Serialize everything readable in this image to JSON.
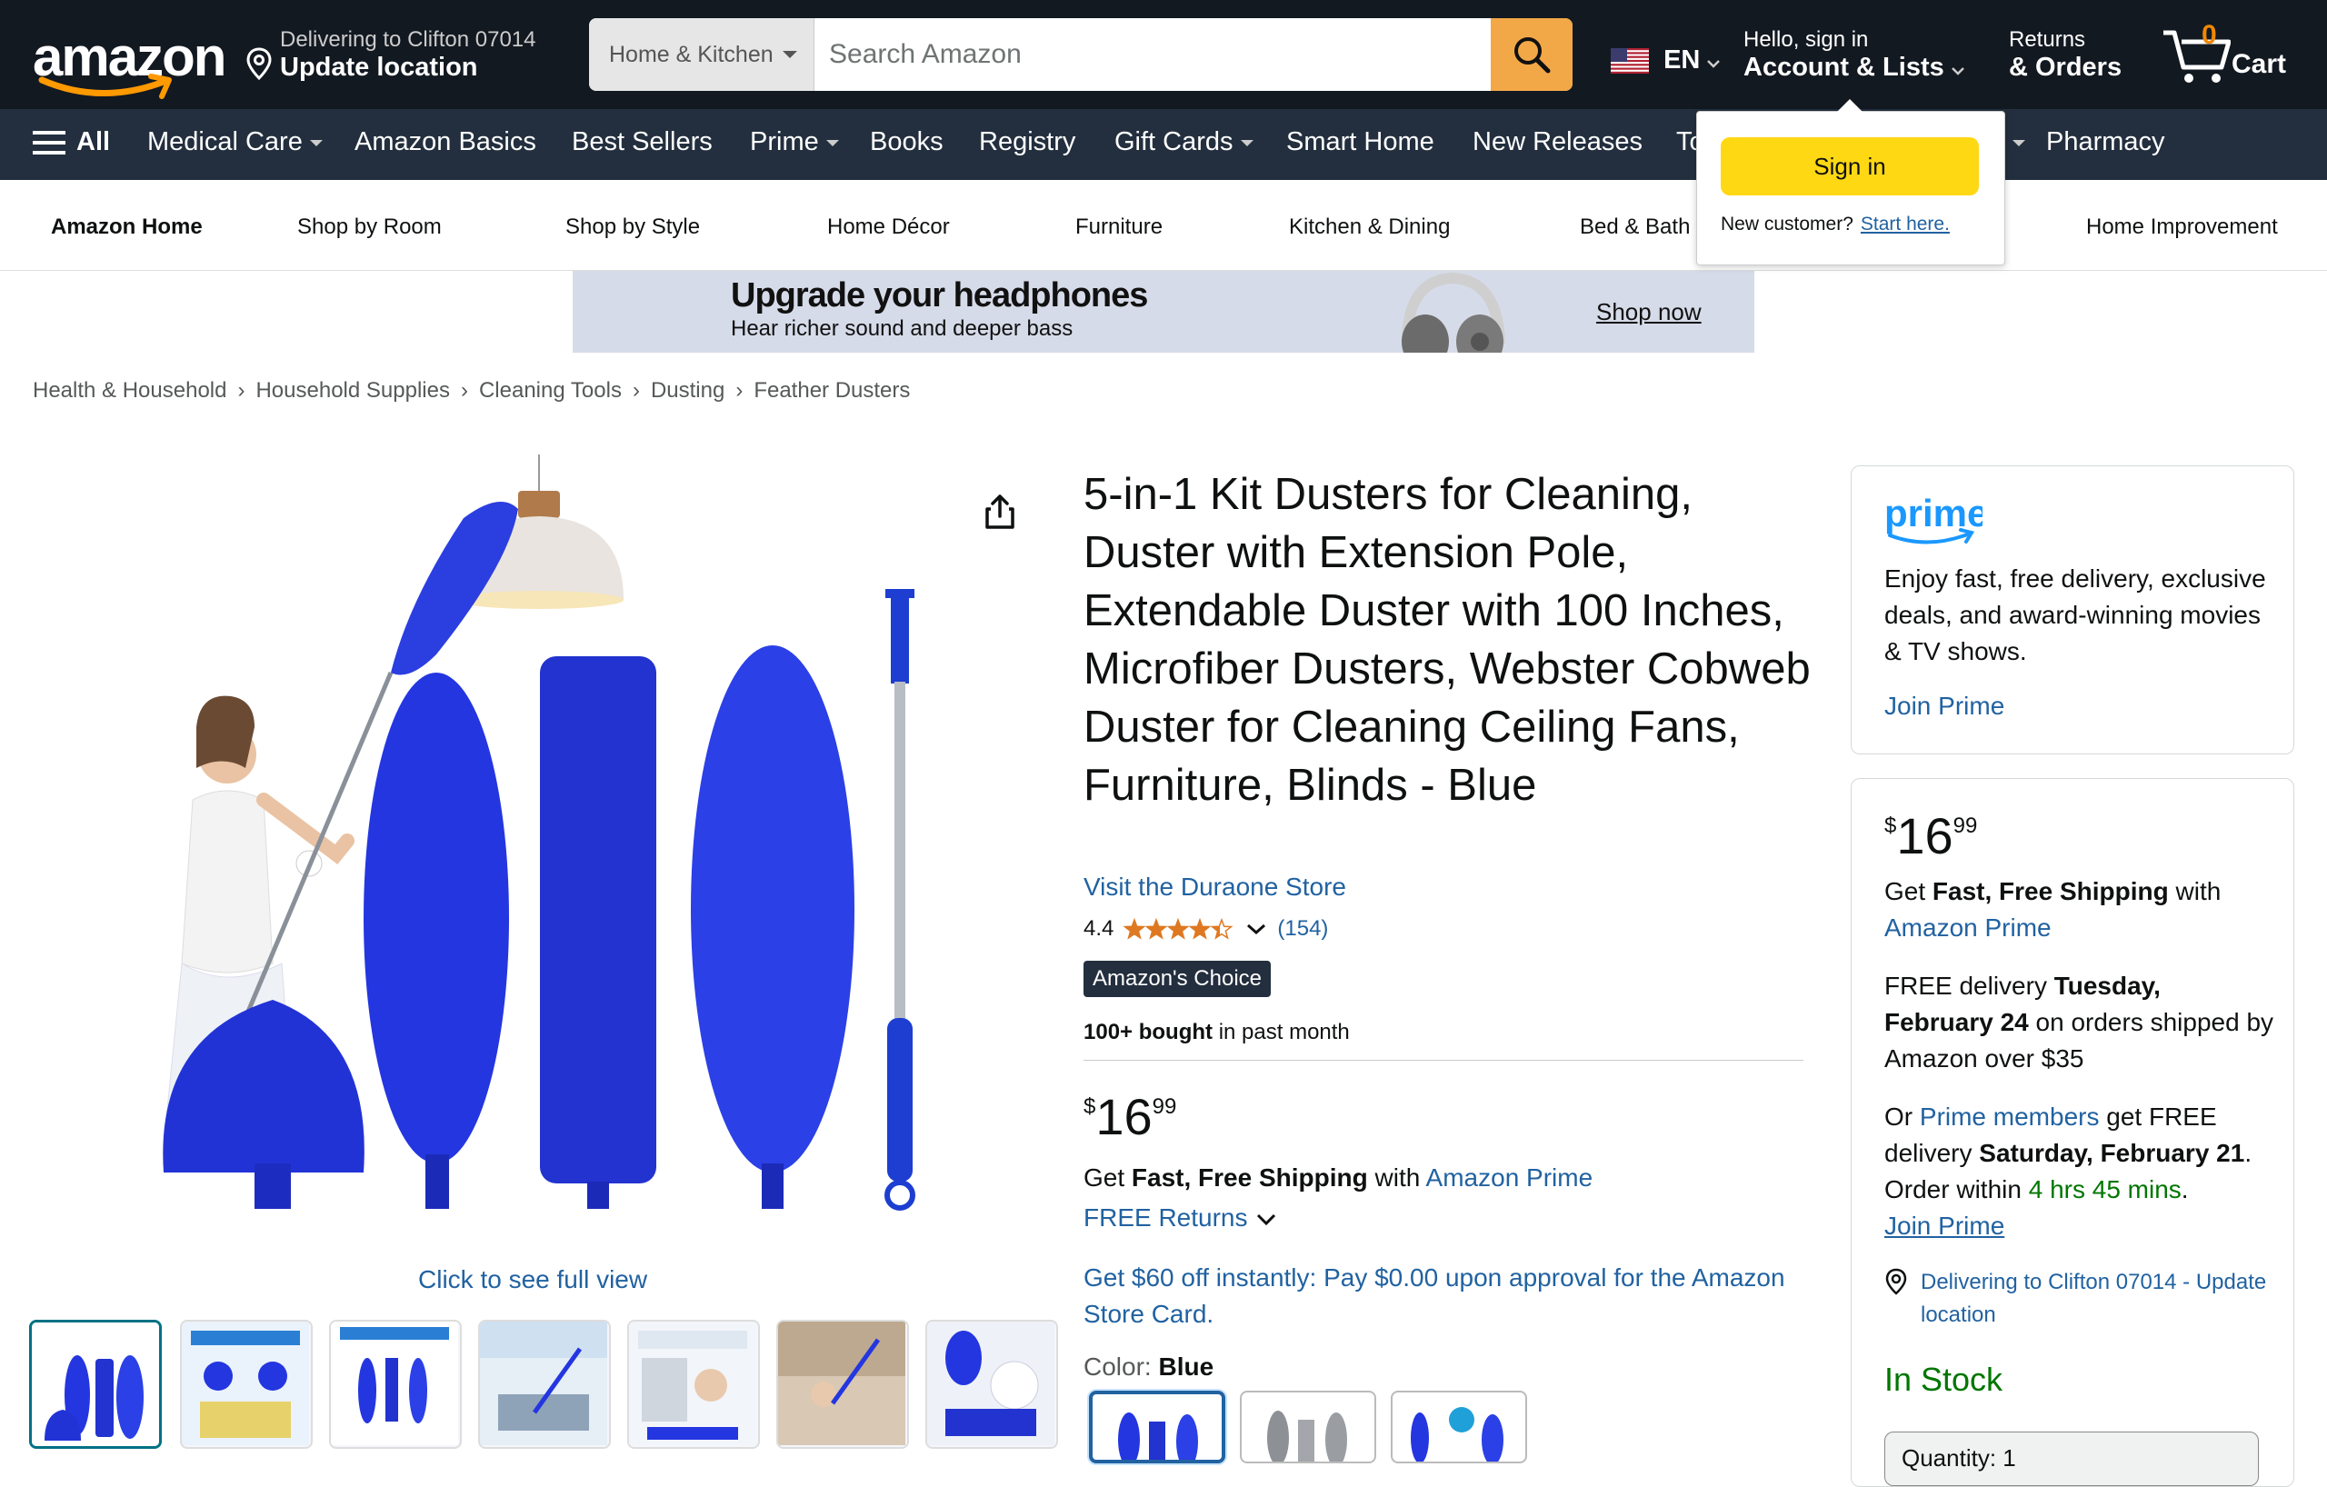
{
  "header": {
    "logo_text": "amazon",
    "delivery_line1": "Delivering to Clifton 07014",
    "delivery_line2": "Update location",
    "search_category": "Home & Kitchen",
    "search_placeholder": "Search Amazon",
    "language": "EN",
    "account_line1": "Hello, sign in",
    "account_line2": "Account & Lists",
    "orders_line1": "Returns",
    "orders_line2": "& Orders",
    "cart_count": "0",
    "cart_label": "Cart"
  },
  "nav": {
    "all_label": "All",
    "items": [
      "Medical Care",
      "Amazon Basics",
      "Best Sellers",
      "Prime",
      "Books",
      "Registry",
      "Gift Cards",
      "Smart Home",
      "New Releases",
      "To",
      "Pharmacy"
    ]
  },
  "subnav": {
    "items": [
      "Amazon Home",
      "Shop by Room",
      "Shop by Style",
      "Home Décor",
      "Furniture",
      "Kitchen & Dining",
      "Bed & Bath",
      "Home Improvement"
    ]
  },
  "banner": {
    "headline": "Upgrade your headphones",
    "subline": "Hear richer sound and deeper bass",
    "cta": "Shop now"
  },
  "flyout": {
    "signin_label": "Sign in",
    "new_customer": "New customer?",
    "start_here": "Start here."
  },
  "breadcrumb": [
    "Health & Household",
    "Household Supplies",
    "Cleaning Tools",
    "Dusting",
    "Feather Dusters"
  ],
  "breadcrumb_sep": "›",
  "gallery": {
    "click_full_view": "Click to see full view"
  },
  "product": {
    "title": "5-in-1 Kit Dusters for Cleaning, Duster with Extension Pole, Extendable Duster with 100 Inches, Microfiber Dusters, Webster Cobweb Duster for Cleaning Ceiling Fans, Furniture, Blinds - Blue",
    "store_link": "Visit the Duraone Store",
    "rating_value": "4.4",
    "rating_stars": 4.4,
    "rating_count": "(154)",
    "badge": "Amazon's Choice",
    "bought_bold": "100+ bought",
    "bought_rest": " in past month",
    "price_symbol": "$",
    "price_whole": "16",
    "price_fraction": "99",
    "shipping_pre": "Get ",
    "shipping_bold": "Fast, Free Shipping",
    "shipping_mid": " with ",
    "shipping_link": "Amazon Prime",
    "returns": "FREE Returns",
    "card_offer": "Get $60 off instantly: Pay $0.00 upon approval for the Amazon Store Card.",
    "color_label": "Color: ",
    "color_value": "Blue"
  },
  "prime_box": {
    "logo": "prime",
    "text": "Enjoy fast, free delivery, exclusive deals, and award-winning movies & TV shows.",
    "join": "Join Prime"
  },
  "buy_box": {
    "price_symbol": "$",
    "price_whole": "16",
    "price_fraction": "99",
    "ship_pre": "Get ",
    "ship_bold": "Fast, Free Shipping",
    "ship_mid": " with",
    "ship_link": "Amazon Prime",
    "del_pre": "FREE delivery ",
    "del_bold": "Tuesday, February 24",
    "del_rest": " on orders shipped by Amazon over $35",
    "or_pre": "Or ",
    "or_link": "Prime members",
    "or_mid": " get FREE delivery ",
    "or_bold": "Saturday, February 21",
    "or_mid2": ". Order within ",
    "or_time": "4 hrs 45 mins",
    "or_end": ".",
    "join_prime": "Join Prime",
    "location": "Delivering to Clifton 07014 - Update location",
    "stock": "In Stock",
    "quantity": "Quantity: 1"
  },
  "colors": {
    "header_bg": "#131921",
    "nav_bg": "#232f3e",
    "accent_orange": "#f3a847",
    "link_blue": "#2162a1",
    "sign_in_yellow": "#ffd814",
    "in_stock_green": "#007600",
    "product_blue": "#1f2fd6"
  }
}
